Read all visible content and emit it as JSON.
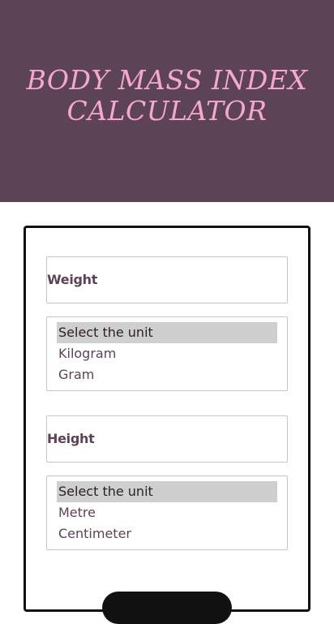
{
  "header": {
    "title_line1": "Body Mass Index",
    "title_line2": "Calculator"
  },
  "form": {
    "weight": {
      "placeholder": "Weight",
      "unit_options": [
        "Select the unit",
        "Kilogram",
        "Gram"
      ],
      "selected_index": 0
    },
    "height": {
      "placeholder": "Height",
      "unit_options": [
        "Select the unit",
        "Metre",
        "Centimeter"
      ],
      "selected_index": 0
    }
  },
  "colors": {
    "header_bg": "#5c4356",
    "title": "#f6a7cf",
    "card_border": "#111111",
    "field_text": "#5c4356"
  }
}
